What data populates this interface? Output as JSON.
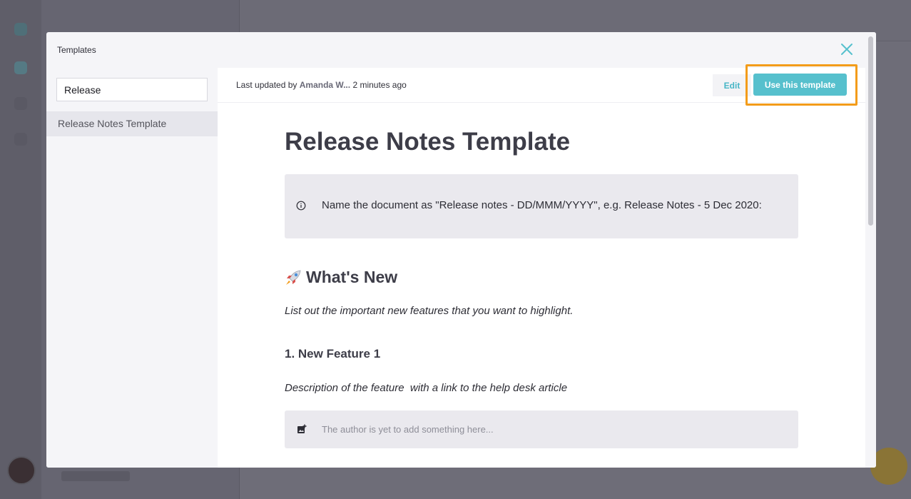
{
  "modal": {
    "title": "Templates",
    "close_icon": "close-icon"
  },
  "search": {
    "value": "Release"
  },
  "template_list": [
    {
      "label": "Release Notes Template",
      "selected": true
    }
  ],
  "header": {
    "last_updated_prefix": "Last updated by",
    "author": "Amanda W...",
    "time": "2 minutes ago",
    "edit_label": "Edit",
    "use_label": "Use this template"
  },
  "document": {
    "title": "Release Notes Template",
    "callout_icon": "info-icon",
    "callout_text": "Name the document as \"Release notes - DD/MMM/YYYY\", e.g. Release Notes - 5 Dec 2020:",
    "section_icon": "rocket-icon",
    "section_heading": "What's New",
    "section_desc": "List out the important new features that you want to highlight.",
    "feature_heading": "1.  New Feature 1",
    "feature_desc": "Description of the feature  with a link to the help desk article",
    "image_icon": "add-image-icon",
    "image_placeholder": "The author is yet to add something here..."
  },
  "colors": {
    "accent": "#56c0cd",
    "highlight": "#f39c1a",
    "overlay": "#6e6d78"
  }
}
